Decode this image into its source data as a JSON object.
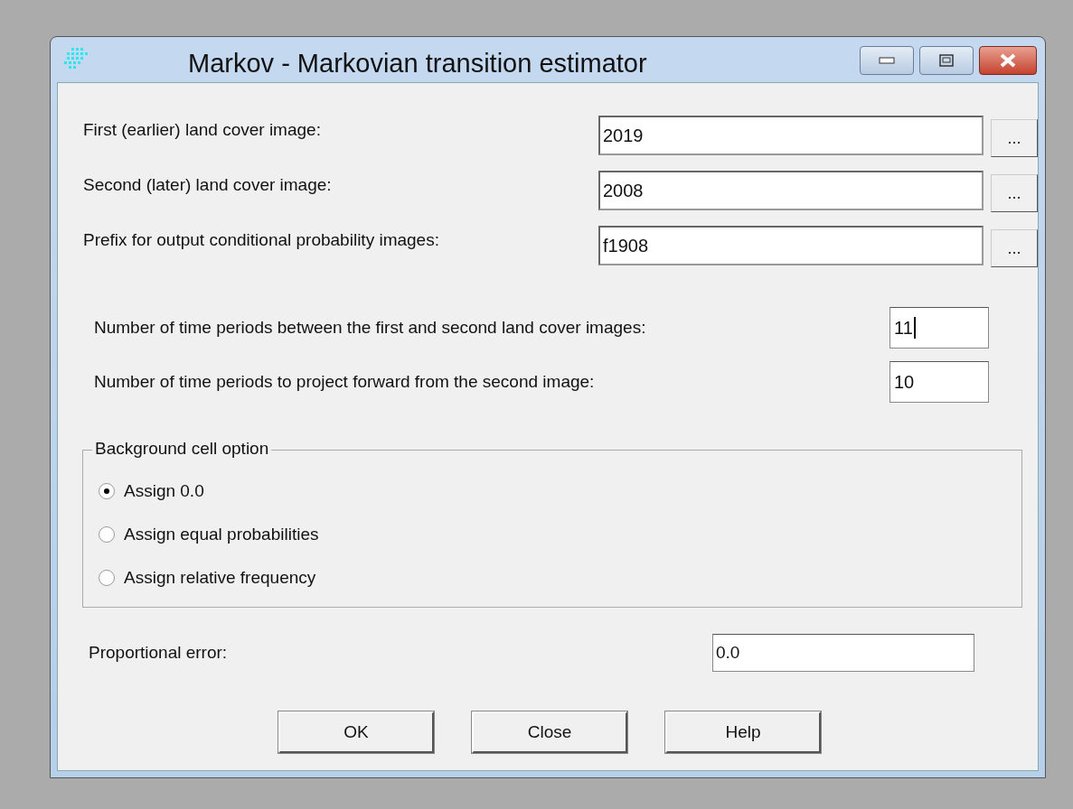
{
  "window": {
    "title": "Markov - Markovian transition estimator"
  },
  "file_fields": [
    {
      "label": "First (earlier) land cover image:",
      "value": "2019",
      "browse": "..."
    },
    {
      "label": "Second (later) land cover image:",
      "value": "2008",
      "browse": "..."
    },
    {
      "label": "Prefix for output conditional probability images:",
      "value": "f1908",
      "browse": "..."
    }
  ],
  "period_fields": [
    {
      "label": "Number of time periods between the first and second land cover images:",
      "value": "11",
      "focused": true
    },
    {
      "label": "Number of time periods to project forward from the second image:",
      "value": "10",
      "focused": false
    }
  ],
  "background_option": {
    "title": "Background cell option",
    "options": [
      {
        "label": "Assign 0.0",
        "selected": true
      },
      {
        "label": "Assign equal probabilities",
        "selected": false
      },
      {
        "label": "Assign relative frequency",
        "selected": false
      }
    ]
  },
  "proportional_error": {
    "label": "Proportional error:",
    "value": "0.0"
  },
  "buttons": [
    "OK",
    "Close",
    "Help"
  ]
}
